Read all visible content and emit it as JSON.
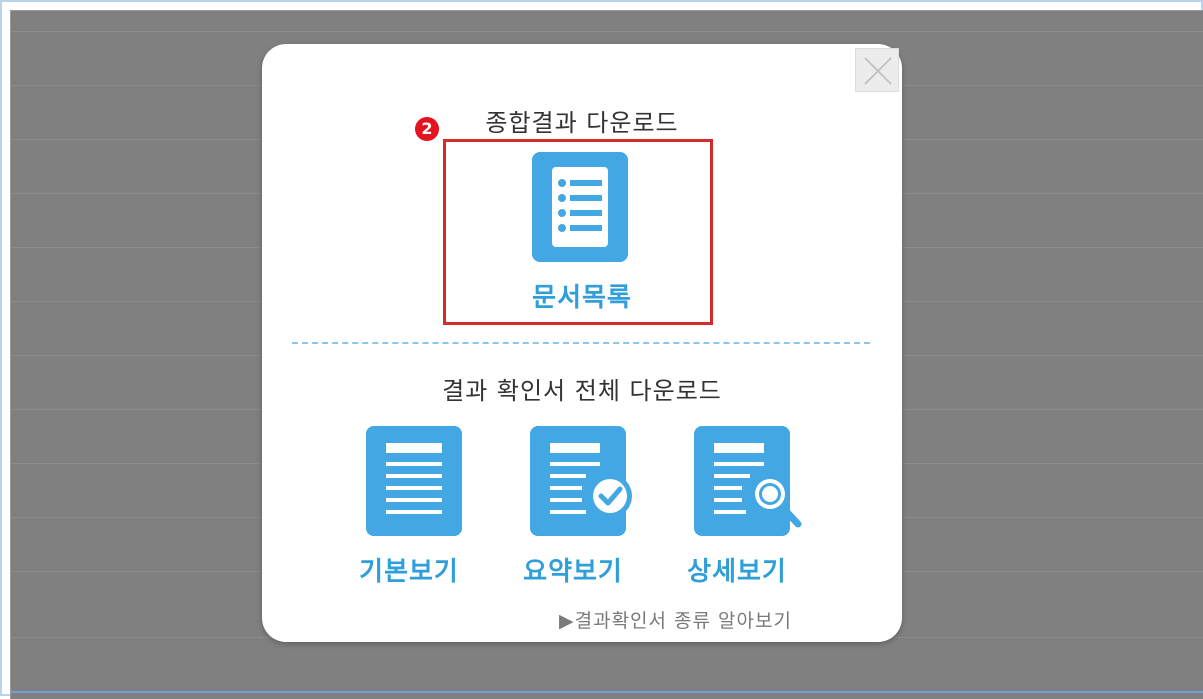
{
  "modal": {
    "close_label": "×",
    "step_number": "2",
    "section1_title": "종합결과 다운로드",
    "doc_list_label": "문서목록",
    "section2_title": "결과 확인서 전체 다운로드",
    "buttons": [
      {
        "label": "기본보기",
        "icon": "document-lines-icon"
      },
      {
        "label": "요약보기",
        "icon": "document-check-icon"
      },
      {
        "label": "상세보기",
        "icon": "document-search-icon"
      }
    ],
    "footer_link": "▶결과확인서 종류 알아보기"
  },
  "colors": {
    "accent": "#42a7e3",
    "label": "#2f9ed9",
    "highlight": "#d42b2b",
    "badge": "#e3141f",
    "overlay": "#808080"
  }
}
